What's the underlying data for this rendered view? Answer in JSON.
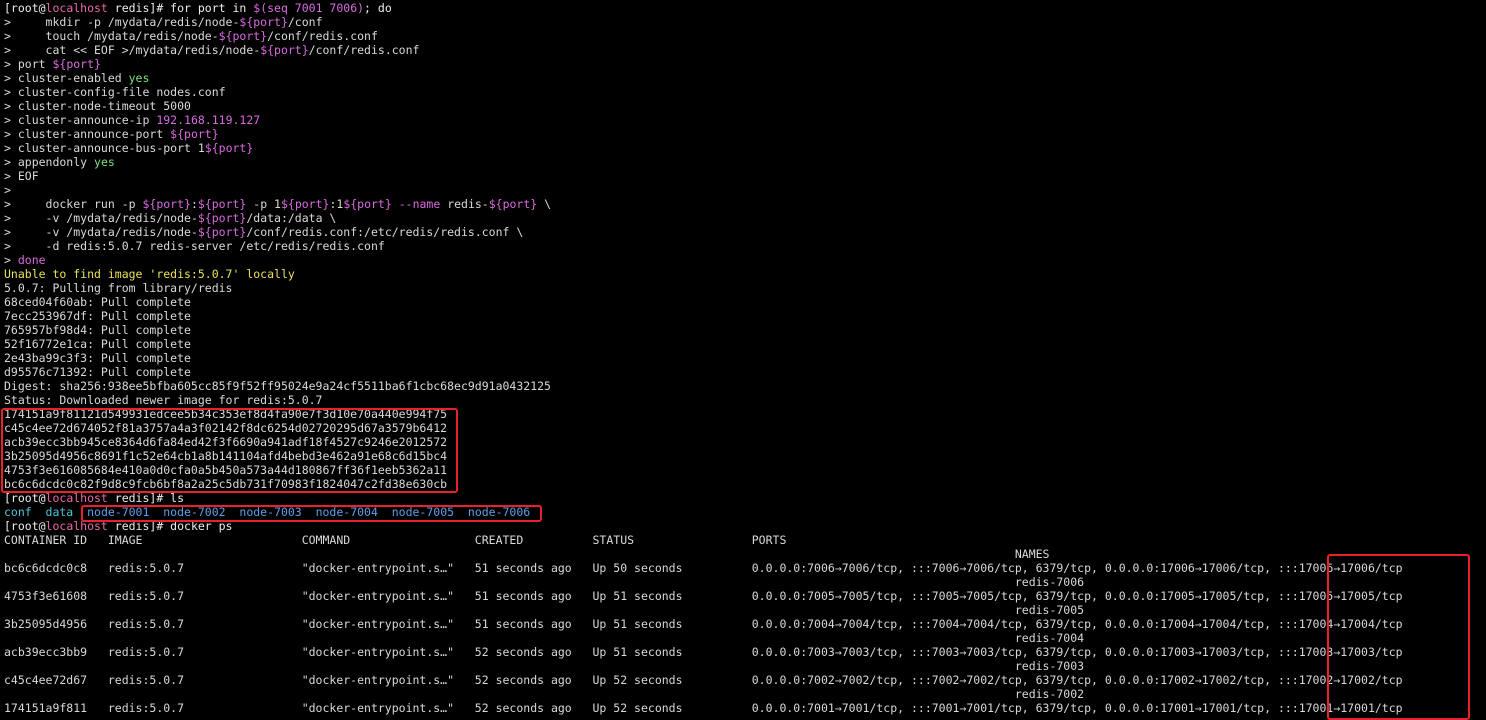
{
  "theme": {
    "background": "#000000",
    "foreground": "#d9d9d9",
    "highlight_box": "#e8212c",
    "green": "#7ee07e",
    "yellow": "#e8e05a",
    "magenta": "#d86adf",
    "cyan": "#4fc3d9",
    "blue": "#5aa0e8"
  },
  "lines": [
    [
      {
        "t": "[root@",
        "c": "white"
      },
      {
        "t": "localhost",
        "c": "host"
      },
      {
        "t": " redis]# for port in ",
        "c": "white"
      },
      {
        "t": "$(seq 7001 7006)",
        "c": "magenta"
      },
      {
        "t": "; do",
        "c": "white"
      }
    ],
    [
      {
        "t": ">     mkdir -p /mydata/redis/node-",
        "c": ""
      },
      {
        "t": "${port}",
        "c": "magenta"
      },
      {
        "t": "/conf",
        "c": ""
      }
    ],
    [
      {
        "t": ">     touch /mydata/redis/node-",
        "c": ""
      },
      {
        "t": "${port}",
        "c": "magenta"
      },
      {
        "t": "/conf/redis.conf",
        "c": ""
      }
    ],
    [
      {
        "t": ">     cat << EOF >/mydata/redis/node-",
        "c": ""
      },
      {
        "t": "${port}",
        "c": "magenta"
      },
      {
        "t": "/conf/redis.conf",
        "c": ""
      }
    ],
    [
      {
        "t": "> port ",
        "c": ""
      },
      {
        "t": "${port}",
        "c": "magenta"
      }
    ],
    [
      {
        "t": "> cluster-enabled ",
        "c": ""
      },
      {
        "t": "yes",
        "c": "green"
      }
    ],
    [
      {
        "t": "> cluster-config-file nodes.conf",
        "c": ""
      }
    ],
    [
      {
        "t": "> cluster-node-timeout 5000",
        "c": ""
      }
    ],
    [
      {
        "t": "> cluster-announce-ip ",
        "c": ""
      },
      {
        "t": "192.168.119.127",
        "c": "magenta"
      }
    ],
    [
      {
        "t": "> cluster-announce-port ",
        "c": ""
      },
      {
        "t": "${port}",
        "c": "magenta"
      }
    ],
    [
      {
        "t": "> cluster-announce-bus-port 1",
        "c": ""
      },
      {
        "t": "${port}",
        "c": "magenta"
      }
    ],
    [
      {
        "t": "> appendonly ",
        "c": ""
      },
      {
        "t": "yes",
        "c": "green"
      }
    ],
    [
      {
        "t": "> EOF",
        "c": ""
      }
    ],
    [
      {
        "t": ">",
        "c": ""
      }
    ],
    [
      {
        "t": ">     docker run -p ",
        "c": ""
      },
      {
        "t": "${port}",
        "c": "magenta"
      },
      {
        "t": ":",
        "c": ""
      },
      {
        "t": "${port}",
        "c": "magenta"
      },
      {
        "t": " -p 1",
        "c": ""
      },
      {
        "t": "${port}",
        "c": "magenta"
      },
      {
        "t": ":1",
        "c": ""
      },
      {
        "t": "${port}",
        "c": "magenta"
      },
      {
        "t": " ",
        "c": ""
      },
      {
        "t": "--name",
        "c": "magenta"
      },
      {
        "t": " redis-",
        "c": ""
      },
      {
        "t": "${port}",
        "c": "magenta"
      },
      {
        "t": " \\",
        "c": ""
      }
    ],
    [
      {
        "t": ">     -v /mydata/redis/node-",
        "c": ""
      },
      {
        "t": "${port}",
        "c": "magenta"
      },
      {
        "t": "/data:/data \\",
        "c": ""
      }
    ],
    [
      {
        "t": ">     -v /mydata/redis/node-",
        "c": ""
      },
      {
        "t": "${port}",
        "c": "magenta"
      },
      {
        "t": "/conf/redis.conf:/etc/redis/redis.conf \\",
        "c": ""
      }
    ],
    [
      {
        "t": ">     -d redis:5.0.7 redis-server /etc/redis/redis.conf",
        "c": ""
      }
    ],
    [
      {
        "t": "> ",
        "c": ""
      },
      {
        "t": "done",
        "c": "magenta"
      }
    ],
    [
      {
        "t": "Unable to find image 'redis:5.0.7' locally",
        "c": "yellow"
      }
    ],
    [
      {
        "t": "5.0.7: Pulling from library/redis",
        "c": ""
      }
    ],
    [
      {
        "t": "68ced04f60ab: Pull complete",
        "c": ""
      }
    ],
    [
      {
        "t": "7ecc253967df: Pull complete",
        "c": ""
      }
    ],
    [
      {
        "t": "765957bf98d4: Pull complete",
        "c": ""
      }
    ],
    [
      {
        "t": "52f16772e1ca: Pull complete",
        "c": ""
      }
    ],
    [
      {
        "t": "2e43ba99c3f3: Pull complete",
        "c": ""
      }
    ],
    [
      {
        "t": "d95576c71392: Pull complete",
        "c": ""
      }
    ],
    [
      {
        "t": "Digest: sha256:938ee5bfba605cc85f9f52ff95024e9a24cf5511ba6f1cbc68ec9d91a0432125",
        "c": ""
      }
    ],
    [
      {
        "t": "Status: Downloaded newer image for redis:5.0.7",
        "c": ""
      }
    ],
    [
      {
        "t": "174151a9f81121d549931edcee5b34c353ef8d4fa90e7f3d10e70a440e994f75",
        "c": ""
      }
    ],
    [
      {
        "t": "c45c4ee72d674052f81a3757a4a3f02142f8dc6254d02720295d67a3579b6412",
        "c": ""
      }
    ],
    [
      {
        "t": "acb39ecc3bb945ce8364d6fa84ed42f3f6690a941adf18f4527c9246e2012572",
        "c": ""
      }
    ],
    [
      {
        "t": "3b25095d4956c8691f1c52e64cb1a8b141104afd4bebd3e462a91e68c6d15bc4",
        "c": ""
      }
    ],
    [
      {
        "t": "4753f3e616085684e410a0d0cfa0a5b450a573a44d180867ff36f1eeb5362a11",
        "c": ""
      }
    ],
    [
      {
        "t": "bc6c6dcdc0c82f9d8c9fcb6bf8a2a25c5db731f70983f1824047c2fd38e630cb",
        "c": ""
      }
    ],
    [
      {
        "t": "[root@",
        "c": "white"
      },
      {
        "t": "localhost",
        "c": "host"
      },
      {
        "t": " redis]# ls",
        "c": "white"
      }
    ],
    [
      {
        "t": "conf  data  ",
        "c": "cyan"
      },
      {
        "t": "node-7001  node-7002  node-7003  node-7004  node-7005  node-7006",
        "c": "blue"
      }
    ],
    [
      {
        "t": "[root@",
        "c": "white"
      },
      {
        "t": "localhost",
        "c": "host"
      },
      {
        "t": " redis]# docker ps",
        "c": "white"
      }
    ],
    [
      {
        "t": "CONTAINER ID   IMAGE                       COMMAND                  CREATED          STATUS                 PORTS",
        "c": ""
      }
    ],
    [
      {
        "t": "                                                                                                                                                  NAMES",
        "c": ""
      }
    ],
    [
      {
        "t": "bc6c6dcdc0c8   redis:5.0.7                 \"docker-entrypoint.s…\"   51 seconds ago   Up 50 seconds          0.0.0.0:7006→7006/tcp, :::7006→7006/tcp, 6379/tcp, 0.0.0.0:17006→17006/tcp, :::17006→17006/tcp",
        "c": ""
      }
    ],
    [
      {
        "t": "                                                                                                                                                  redis-7006",
        "c": ""
      }
    ],
    [
      {
        "t": "4753f3e61608   redis:5.0.7                 \"docker-entrypoint.s…\"   51 seconds ago   Up 51 seconds          0.0.0.0:7005→7005/tcp, :::7005→7005/tcp, 6379/tcp, 0.0.0.0:17005→17005/tcp, :::17005→17005/tcp",
        "c": ""
      }
    ],
    [
      {
        "t": "                                                                                                                                                  redis-7005",
        "c": ""
      }
    ],
    [
      {
        "t": "3b25095d4956   redis:5.0.7                 \"docker-entrypoint.s…\"   51 seconds ago   Up 51 seconds          0.0.0.0:7004→7004/tcp, :::7004→7004/tcp, 6379/tcp, 0.0.0.0:17004→17004/tcp, :::17004→17004/tcp",
        "c": ""
      }
    ],
    [
      {
        "t": "                                                                                                                                                  redis-7004",
        "c": ""
      }
    ],
    [
      {
        "t": "acb39ecc3bb9   redis:5.0.7                 \"docker-entrypoint.s…\"   52 seconds ago   Up 51 seconds          0.0.0.0:7003→7003/tcp, :::7003→7003/tcp, 6379/tcp, 0.0.0.0:17003→17003/tcp, :::17003→17003/tcp",
        "c": ""
      }
    ],
    [
      {
        "t": "                                                                                                                                                  redis-7003",
        "c": ""
      }
    ],
    [
      {
        "t": "c45c4ee72d67   redis:5.0.7                 \"docker-entrypoint.s…\"   52 seconds ago   Up 52 seconds          0.0.0.0:7002→7002/tcp, :::7002→7002/tcp, 6379/tcp, 0.0.0.0:17002→17002/tcp, :::17002→17002/tcp",
        "c": ""
      }
    ],
    [
      {
        "t": "                                                                                                                                                  redis-7002",
        "c": ""
      }
    ],
    [
      {
        "t": "174151a9f811   redis:5.0.7                 \"docker-entrypoint.s…\"   52 seconds ago   Up 52 seconds          0.0.0.0:7001→7001/tcp, :::7001→7001/tcp, 6379/tcp, 0.0.0.0:17001→17001/tcp, :::17001→17001/tcp",
        "c": ""
      }
    ]
  ]
}
